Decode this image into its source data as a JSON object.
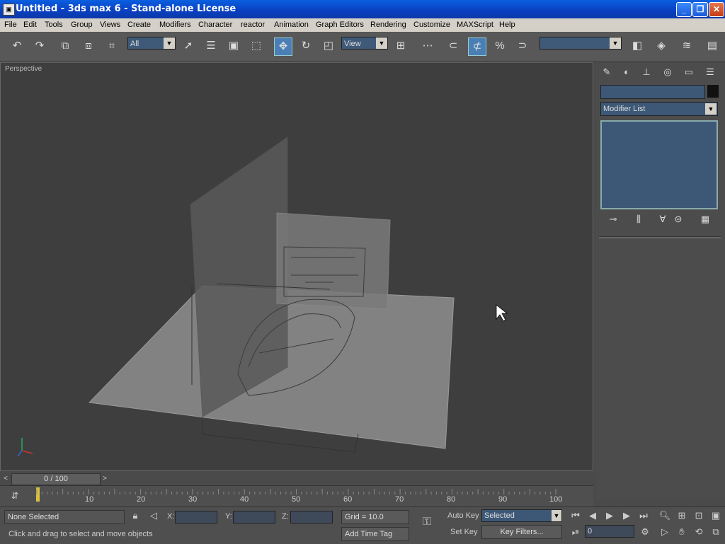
{
  "window": {
    "title": "Untitled - 3ds max 6 - Stand-alone License"
  },
  "menu": [
    "File",
    "Edit",
    "Tools",
    "Group",
    "Views",
    "Create",
    "Modifiers",
    "Character",
    "reactor",
    "Animation",
    "Graph Editors",
    "Rendering",
    "Customize",
    "MAXScript",
    "Help"
  ],
  "toolbar": {
    "selection_filter": "All",
    "ref_coord": "View",
    "named_selection": ""
  },
  "viewport": {
    "label": "Perspective"
  },
  "command_panel": {
    "modifier_list": "Modifier List"
  },
  "time_slider": {
    "position": "0 / 100"
  },
  "track_ticks": [
    "10",
    "20",
    "30",
    "40",
    "50",
    "60",
    "70",
    "80",
    "90",
    "100"
  ],
  "status": {
    "selection": "None Selected",
    "prompt": "Click and drag to select and move objects",
    "x_label": "X:",
    "y_label": "Y:",
    "z_label": "Z:",
    "grid": "Grid = 10.0",
    "add_time_tag": "Add Time Tag",
    "auto_key": "Auto Key",
    "set_key": "Set Key",
    "key_mode": "Selected",
    "key_filters": "Key Filters...",
    "current_frame": "0"
  }
}
